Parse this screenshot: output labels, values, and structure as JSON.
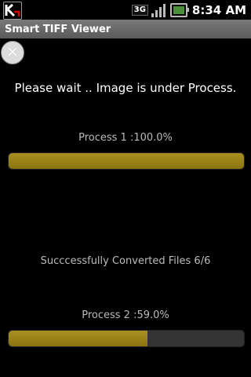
{
  "status_bar": {
    "network": "3G",
    "time": "8:34 AM",
    "icons": [
      "app-notification-icon",
      "3g-icon",
      "signal-icon",
      "battery-icon"
    ]
  },
  "title_bar": {
    "title": "Smart TIFF Viewer"
  },
  "close_button": {
    "icon": "close-icon"
  },
  "message": "Please wait .. Image is under Process.",
  "process1": {
    "label": "Process 1 :100.0%",
    "progress": 1.0
  },
  "summary": "Succcessfully Converted Files 6/6",
  "process2": {
    "label": "Process 2 :59.0%",
    "progress": 0.59
  },
  "colors": {
    "bar_fill": "#a99020",
    "bar_track": "#333333",
    "title_bar": "#6e6e6e"
  }
}
